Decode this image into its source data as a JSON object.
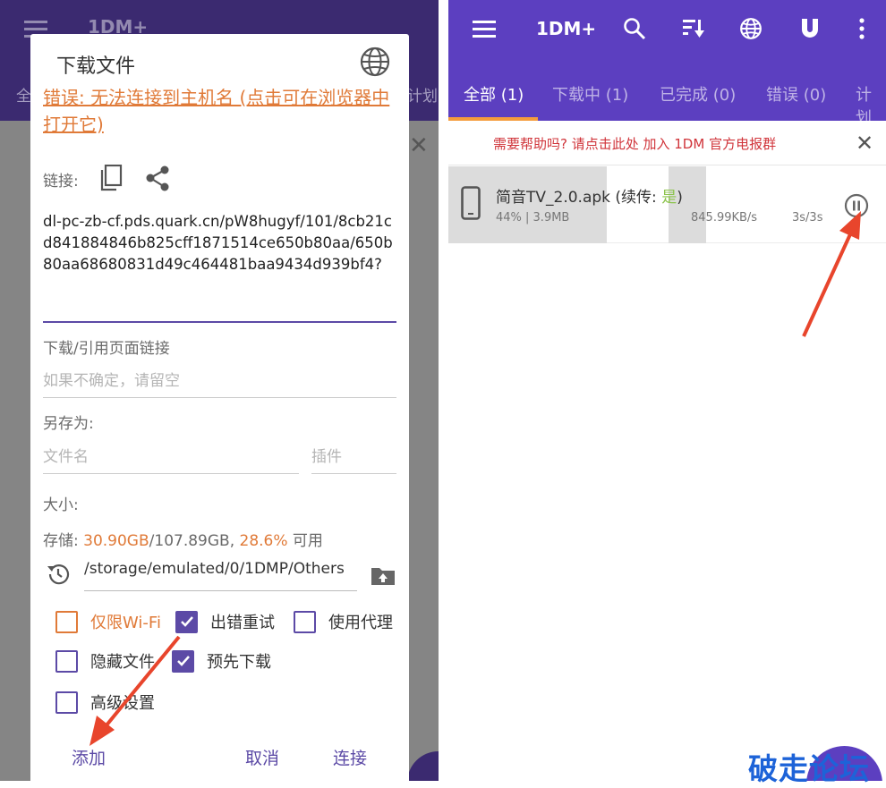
{
  "left": {
    "background_app": {
      "title": "1DM+",
      "tab_partial_left": "全",
      "tab_partial_right": "计划"
    },
    "dialog": {
      "title": "下载文件",
      "error_text": "错误: 无法连接到主机名 (点击可在浏览器中打开它)",
      "link_label": "链接:",
      "url": "dl-pc-zb-cf.pds.quark.cn/pW8hugyf/101/8cb21cd841884846b825cff1871514ce650b80aa/650b80aa68680831d49c464481baa9434d939bf4?",
      "referer_label": "下载/引用页面链接",
      "referer_placeholder": "如果不确定，请留空",
      "save_as_label": "另存为:",
      "filename_placeholder": "文件名",
      "plugin_placeholder": "插件",
      "size_label": "大小:",
      "storage_prefix": "存储: ",
      "storage_free": "30.90GB",
      "storage_total": "/107.89GB, ",
      "storage_pct": "28.6%",
      "storage_suffix": " 可用",
      "path": "/storage/emulated/0/1DMP/Others",
      "options": [
        {
          "label": "仅限Wi-Fi",
          "checked": false
        },
        {
          "label": "出错重试",
          "checked": true
        },
        {
          "label": "使用代理",
          "checked": false
        },
        {
          "label": "隐藏文件",
          "checked": false
        },
        {
          "label": "预先下载",
          "checked": true
        },
        {
          "label": "高级设置",
          "checked": false
        }
      ],
      "add_button": "添加",
      "cancel_button": "取消",
      "connect_button": "连接"
    }
  },
  "right": {
    "title": "1DM+",
    "tabs": [
      "全部 (1)",
      "下载中 (1)",
      "已完成 (0)",
      "错误 (0)",
      "计划"
    ],
    "banner": "需要帮助吗? 请点击此处 加入 1DM 官方电报群",
    "download": {
      "name": "简音TV_2.0.apk (续传: ",
      "resume": "是",
      "name_end": ")",
      "progress_text": "44% | 3.9MB",
      "progress": 0.44,
      "speed": "845.99KB/s",
      "time": "3s/3s"
    }
  },
  "watermark": "破走论坛",
  "colors": {
    "primary": "#5c3fc0",
    "accent_orange": "#e07a38",
    "checkbox": "#5c4aa6",
    "banner_red": "#d0343a",
    "watermark": "#1d63d8",
    "arrow": "#e8452c"
  }
}
